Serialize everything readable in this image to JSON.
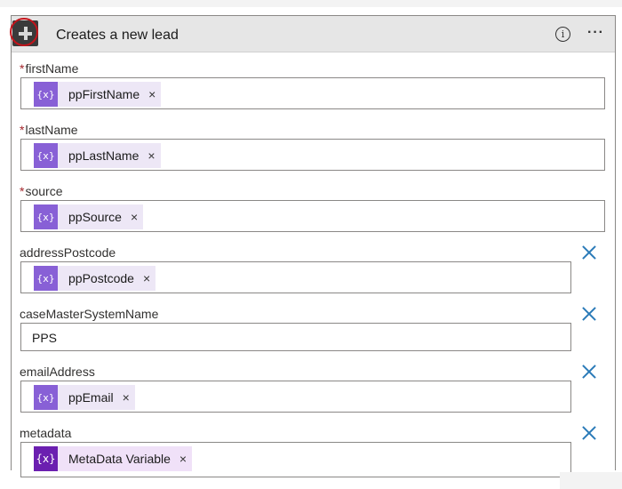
{
  "card": {
    "title": "Creates a new lead",
    "info_glyph": "i",
    "more_glyph": "···"
  },
  "fields": [
    {
      "label": "firstName",
      "required": true,
      "required_mark": "*",
      "type": "token",
      "token": "ppFirstName",
      "token_icon": "{x}",
      "removable": false
    },
    {
      "label": "lastName",
      "required": true,
      "required_mark": "*",
      "type": "token",
      "token": "ppLastName",
      "token_icon": "{x}",
      "removable": false
    },
    {
      "label": "source",
      "required": true,
      "required_mark": "*",
      "type": "token",
      "token": "ppSource",
      "token_icon": "{x}",
      "removable": false
    },
    {
      "label": "addressPostcode",
      "required": false,
      "type": "token",
      "token": "ppPostcode",
      "token_icon": "{x}",
      "removable": true
    },
    {
      "label": "caseMasterSystemName",
      "required": false,
      "type": "text",
      "value": "PPS",
      "removable": true
    },
    {
      "label": "emailAddress",
      "required": false,
      "type": "token",
      "token": "ppEmail",
      "token_icon": "{x}",
      "removable": true
    },
    {
      "label": "metadata",
      "required": false,
      "type": "token",
      "token": "MetaData Variable",
      "token_icon": "{x}",
      "removable": true
    }
  ],
  "token_remove_glyph": "×",
  "colors": {
    "header_bg": "#e6e6e6",
    "token_bg": "#ede7f6",
    "token_icon_bg": "#8860d6",
    "meta_token_bg": "#f0e1f8",
    "meta_token_icon_bg": "#6b1fb0",
    "required": "#a4262c",
    "remove_icon": "#2a7ab8",
    "highlight_ring": "#c4141b"
  }
}
